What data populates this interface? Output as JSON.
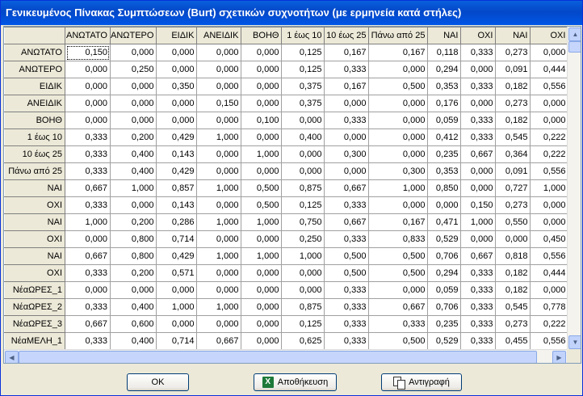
{
  "window": {
    "title": "Γενικευμένος Πίνακας Συμπτώσεων (Burt) σχετικών συχνοτήτων (με ερμηνεία κατά στήλες)"
  },
  "grid": {
    "columns": [
      "ΑΝΩΤΑΤΟ",
      "ΑΝΩΤΕΡΟ",
      "ΕΙΔΙΚ",
      "ΑΝΕΙΔΙΚ",
      "ΒΟΗΘ",
      "1 έως 10",
      "10 έως 25",
      "Πάνω από 25",
      "ΝΑΙ",
      "ΟΧΙ",
      "ΝΑΙ",
      "ΟΧΙ"
    ],
    "rows": [
      {
        "label": "ΑΝΩΤΑΤΟ",
        "values": [
          "0,150",
          "0,000",
          "0,000",
          "0,000",
          "0,000",
          "0,125",
          "0,167",
          "0,167",
          "0,118",
          "0,333",
          "0,273",
          "0,000"
        ]
      },
      {
        "label": "ΑΝΩΤΕΡΟ",
        "values": [
          "0,000",
          "0,250",
          "0,000",
          "0,000",
          "0,000",
          "0,125",
          "0,333",
          "0,000",
          "0,294",
          "0,000",
          "0,091",
          "0,444"
        ]
      },
      {
        "label": "ΕΙΔΙΚ",
        "values": [
          "0,000",
          "0,000",
          "0,350",
          "0,000",
          "0,000",
          "0,375",
          "0,167",
          "0,500",
          "0,353",
          "0,333",
          "0,182",
          "0,556"
        ]
      },
      {
        "label": "ΑΝΕΙΔΙΚ",
        "values": [
          "0,000",
          "0,000",
          "0,000",
          "0,150",
          "0,000",
          "0,375",
          "0,000",
          "0,000",
          "0,176",
          "0,000",
          "0,273",
          "0,000"
        ]
      },
      {
        "label": "ΒΟΗΘ",
        "values": [
          "0,000",
          "0,000",
          "0,000",
          "0,000",
          "0,100",
          "0,000",
          "0,333",
          "0,000",
          "0,059",
          "0,333",
          "0,182",
          "0,000"
        ]
      },
      {
        "label": "1 έως 10",
        "values": [
          "0,333",
          "0,200",
          "0,429",
          "1,000",
          "0,000",
          "0,400",
          "0,000",
          "0,000",
          "0,412",
          "0,333",
          "0,545",
          "0,222"
        ]
      },
      {
        "label": "10 έως 25",
        "values": [
          "0,333",
          "0,400",
          "0,143",
          "0,000",
          "1,000",
          "0,000",
          "0,300",
          "0,000",
          "0,235",
          "0,667",
          "0,364",
          "0,222"
        ]
      },
      {
        "label": "Πάνω από 25",
        "values": [
          "0,333",
          "0,400",
          "0,429",
          "0,000",
          "0,000",
          "0,000",
          "0,000",
          "0,300",
          "0,353",
          "0,000",
          "0,091",
          "0,556"
        ]
      },
      {
        "label": "ΝΑΙ",
        "values": [
          "0,667",
          "1,000",
          "0,857",
          "1,000",
          "0,500",
          "0,875",
          "0,667",
          "1,000",
          "0,850",
          "0,000",
          "0,727",
          "1,000"
        ]
      },
      {
        "label": "ΟΧΙ",
        "values": [
          "0,333",
          "0,000",
          "0,143",
          "0,000",
          "0,500",
          "0,125",
          "0,333",
          "0,000",
          "0,000",
          "0,150",
          "0,273",
          "0,000"
        ]
      },
      {
        "label": "ΝΑΙ",
        "values": [
          "1,000",
          "0,200",
          "0,286",
          "1,000",
          "1,000",
          "0,750",
          "0,667",
          "0,167",
          "0,471",
          "1,000",
          "0,550",
          "0,000"
        ]
      },
      {
        "label": "ΟΧΙ",
        "values": [
          "0,000",
          "0,800",
          "0,714",
          "0,000",
          "0,000",
          "0,250",
          "0,333",
          "0,833",
          "0,529",
          "0,000",
          "0,000",
          "0,450"
        ]
      },
      {
        "label": "ΝΑΙ",
        "values": [
          "0,667",
          "0,800",
          "0,429",
          "1,000",
          "1,000",
          "1,000",
          "0,500",
          "0,500",
          "0,706",
          "0,667",
          "0,818",
          "0,556"
        ]
      },
      {
        "label": "ΟΧΙ",
        "values": [
          "0,333",
          "0,200",
          "0,571",
          "0,000",
          "0,000",
          "0,000",
          "0,500",
          "0,500",
          "0,294",
          "0,333",
          "0,182",
          "0,444"
        ]
      },
      {
        "label": "ΝέαΩΡΕΣ_1",
        "values": [
          "0,000",
          "0,000",
          "0,000",
          "0,000",
          "0,000",
          "0,000",
          "0,333",
          "0,000",
          "0,059",
          "0,333",
          "0,182",
          "0,000"
        ]
      },
      {
        "label": "ΝέαΩΡΕΣ_2",
        "values": [
          "0,333",
          "0,400",
          "1,000",
          "1,000",
          "0,000",
          "0,875",
          "0,333",
          "0,667",
          "0,706",
          "0,333",
          "0,545",
          "0,778"
        ]
      },
      {
        "label": "ΝέαΩΡΕΣ_3",
        "values": [
          "0,667",
          "0,600",
          "0,000",
          "0,000",
          "0,000",
          "0,125",
          "0,333",
          "0,333",
          "0,235",
          "0,333",
          "0,273",
          "0,222"
        ]
      },
      {
        "label": "ΝέαΜΕΛΗ_1",
        "values": [
          "0,333",
          "0,400",
          "0,714",
          "0,667",
          "0,000",
          "0,625",
          "0,333",
          "0,500",
          "0,529",
          "0,333",
          "0,455",
          "0,556"
        ]
      }
    ]
  },
  "buttons": {
    "ok": "OK",
    "save": "Αποθήκευση",
    "copy": "Αντιγραφή"
  },
  "icons": {
    "save": "excel-icon",
    "copy": "copy-icon"
  }
}
